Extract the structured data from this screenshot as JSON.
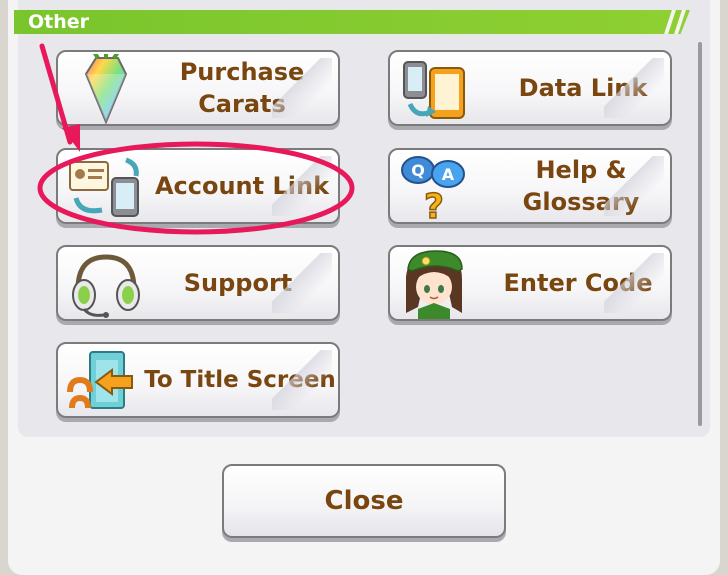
{
  "section": {
    "title": "Other"
  },
  "buttons": {
    "purchase_carats": {
      "line1": "Purchase",
      "line2": "Carats",
      "icon": "prism-crystal-icon"
    },
    "data_link": {
      "label": "Data Link",
      "icon": "phone-transfer-icon"
    },
    "account_link": {
      "label": "Account Link",
      "icon": "id-card-icon"
    },
    "help_glossary": {
      "line1": "Help &",
      "line2": "Glossary",
      "icon": "qa-bubble-icon"
    },
    "support": {
      "label": "Support",
      "icon": "headphones-icon"
    },
    "enter_code": {
      "label": "Enter Code",
      "icon": "character-portrait-icon"
    },
    "to_title_screen": {
      "label": "To Title Screen",
      "icon": "exit-door-icon"
    }
  },
  "close": {
    "label": "Close"
  },
  "colors": {
    "header_green": "#79c52c",
    "label_brown": "#7a4610",
    "annotation_pink": "#e8195a"
  }
}
